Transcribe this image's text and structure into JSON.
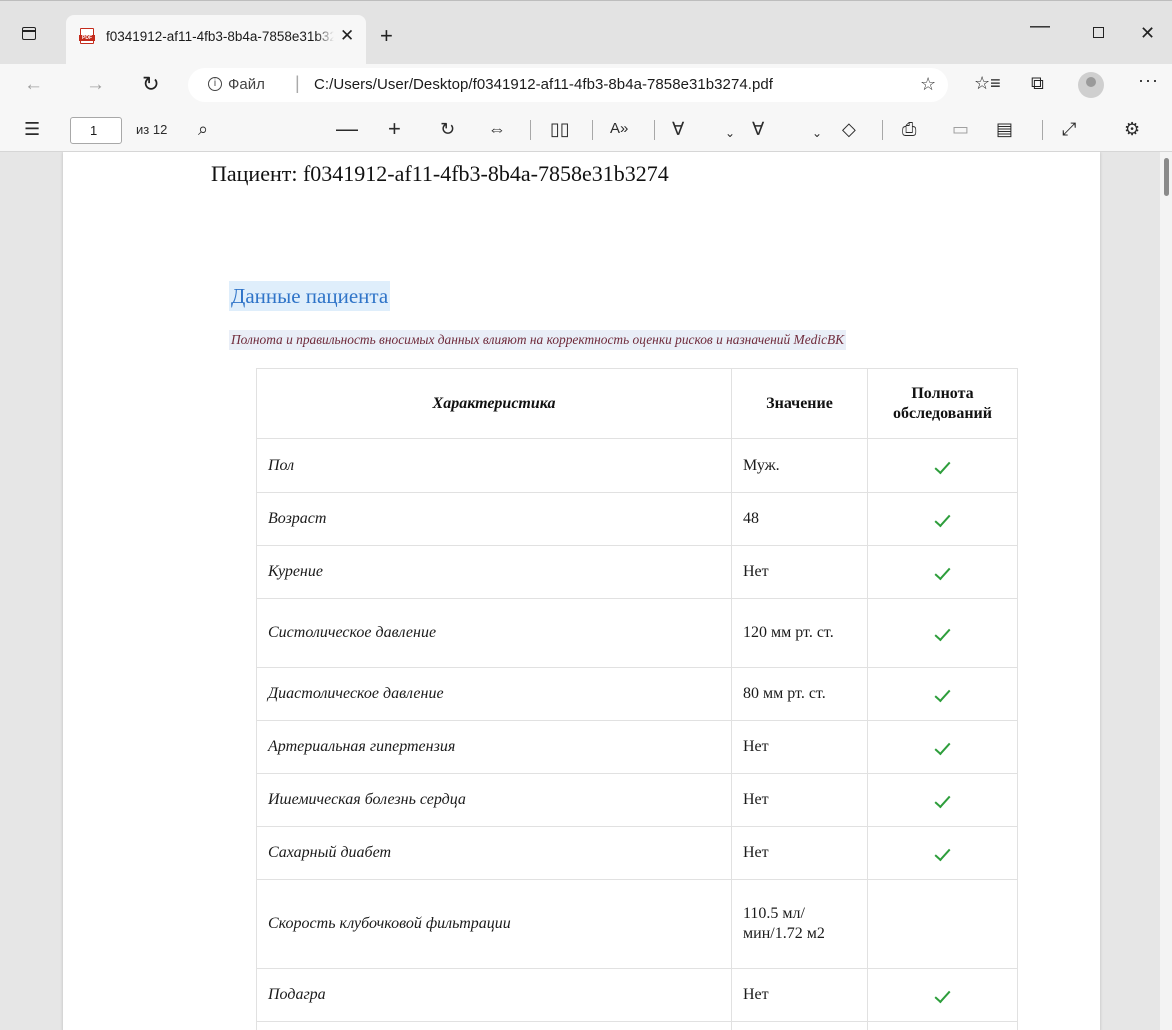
{
  "browser": {
    "tab_title": "f0341912-af11-4fb3-8b4a-7858e31b3274.pdf",
    "url_scheme_label": "Файл",
    "url_path": "C:/Users/User/Desktop/f0341912-af11-4fb3-8b4a-7858e31b3274.pdf"
  },
  "pdf_toolbar": {
    "page_current": "1",
    "page_total": "из 12"
  },
  "document": {
    "patient_title": "Пациент: f0341912-af11-4fb3-8b4a-7858e31b3274",
    "section_title": "Данные пациента",
    "note": "Полнота и правильность вносимых данных влияют на корректность оценки рисков и назначений MedicBK",
    "table": {
      "headers": [
        "Характеристика",
        "Значение",
        "Полнота обследований"
      ],
      "rows": [
        {
          "name": "Пол",
          "value": "Муж.",
          "complete": true
        },
        {
          "name": "Возраст",
          "value": "48",
          "complete": true
        },
        {
          "name": "Курение",
          "value": "Нет",
          "complete": true
        },
        {
          "name": "Систолическое давление",
          "value": "120 мм рт. ст.",
          "complete": true
        },
        {
          "name": "Диастолическое давление",
          "value": "80 мм рт. ст.",
          "complete": true
        },
        {
          "name": "Артериальная гипертензия",
          "value": "Нет",
          "complete": true
        },
        {
          "name": "Ишемическая болезнь сердца",
          "value": "Нет",
          "complete": true
        },
        {
          "name": "Сахарный диабет",
          "value": "Нет",
          "complete": true
        },
        {
          "name": "Скорость клубочковой фильтрации",
          "value": "110.5 мл/мин/1.72 м2",
          "complete": false
        },
        {
          "name": "Подагра",
          "value": "Нет",
          "complete": true
        }
      ]
    }
  },
  "colors": {
    "section_title": "#2f74c8",
    "check": "#2e9e3c",
    "muted_value": "#a6a6a6"
  }
}
